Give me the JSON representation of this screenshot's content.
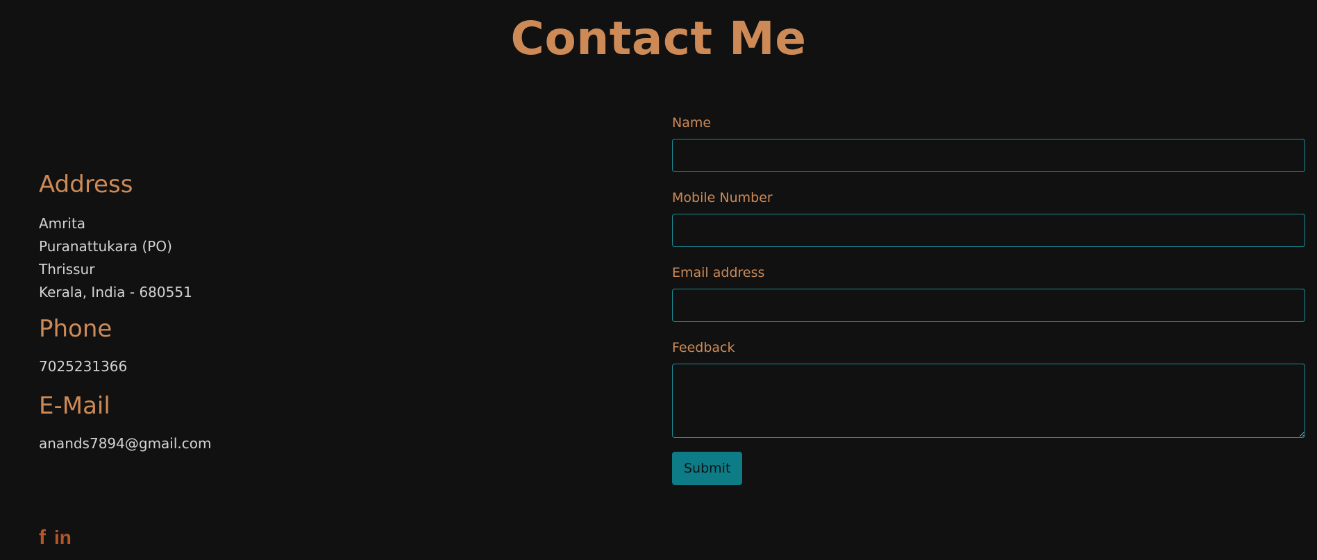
{
  "page": {
    "title": "Contact Me"
  },
  "contact_info": {
    "address": {
      "heading": "Address",
      "lines": [
        "Amrita",
        "Puranattukara (PO)",
        "Thrissur",
        "Kerala, India - 680551"
      ]
    },
    "phone": {
      "heading": "Phone",
      "value": "7025231366"
    },
    "email": {
      "heading": "E-Mail",
      "value": "anands7894@gmail.com"
    }
  },
  "social": {
    "facebook_glyph": "f",
    "linkedin_glyph": "in",
    "icons": [
      "facebook-icon",
      "linkedin-icon"
    ]
  },
  "form": {
    "name_label": "Name",
    "name_value": "",
    "mobile_label": "Mobile Number",
    "mobile_value": "",
    "email_label": "Email address",
    "email_value": "",
    "feedback_label": "Feedback",
    "feedback_value": "",
    "submit_label": "Submit"
  },
  "colors": {
    "background": "#111111",
    "accent": "#cd8a57",
    "input_border": "#1b8f99",
    "button": "#0e7c86",
    "social_icon": "#b5562a",
    "text": "#d4d4d4"
  }
}
